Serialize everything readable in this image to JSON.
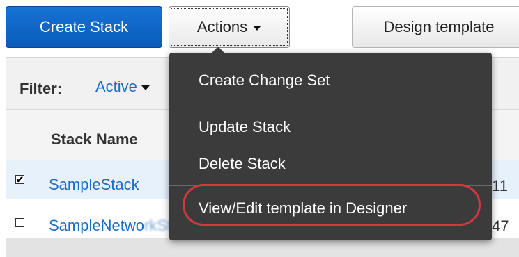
{
  "toolbar": {
    "create_stack_label": "Create Stack",
    "actions_label": "Actions",
    "design_template_label": "Design template"
  },
  "filter": {
    "label": "Filter:",
    "value": "Active"
  },
  "table": {
    "columns": [
      "Stack Name"
    ],
    "rows": [
      {
        "checked": true,
        "checkbox_glyph": "✔",
        "name": "SampleStack",
        "time_fragment": ":11"
      },
      {
        "checked": false,
        "checkbox_glyph": "",
        "name_visible": "SampleNetwo",
        "time_fragment": ":47"
      }
    ]
  },
  "actions_menu": {
    "items": [
      {
        "label": "Create Change Set"
      },
      {
        "label": "Update Stack"
      },
      {
        "label": "Delete Stack"
      },
      {
        "label": "View/Edit template in Designer",
        "highlighted": true
      }
    ]
  },
  "colors": {
    "primary_button": "#0a5bb8",
    "link": "#1a6dc8",
    "menu_bg": "#3b3b3b",
    "highlight_ring": "#d0393e",
    "selected_row": "#e6f1fc"
  },
  "icons": {
    "actions_caret": "chevron-down-icon",
    "filter_caret": "chevron-down-icon"
  }
}
